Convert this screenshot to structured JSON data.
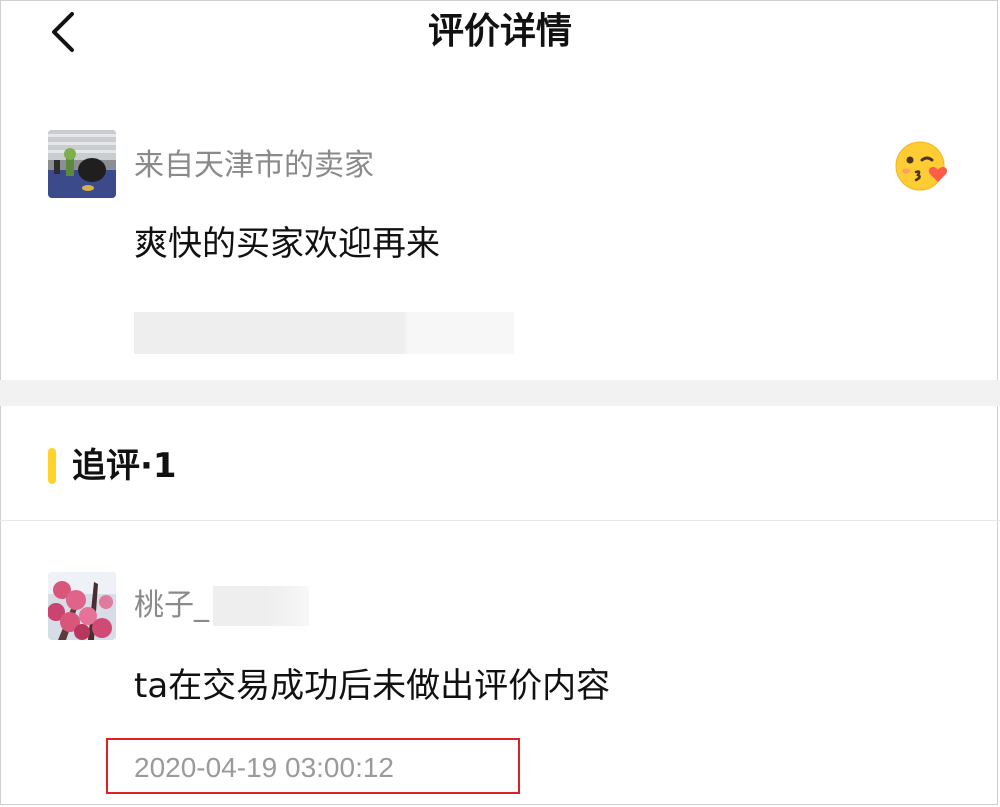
{
  "header": {
    "title": "评价详情",
    "back_icon": "chevron-left-icon"
  },
  "seller_review": {
    "reviewer_name": "来自天津市的卖家",
    "text": "爽快的买家欢迎再来",
    "reaction_icon": "kissing-face-with-heart-icon"
  },
  "followup": {
    "title": "追评·1",
    "accent_color": "#ffd32a"
  },
  "buyer_review": {
    "reviewer_name": "桃子_",
    "text": "ta在交易成功后未做出评价内容",
    "timestamp": "2020-04-19 03:00:12",
    "highlight_color": "#e02020"
  }
}
